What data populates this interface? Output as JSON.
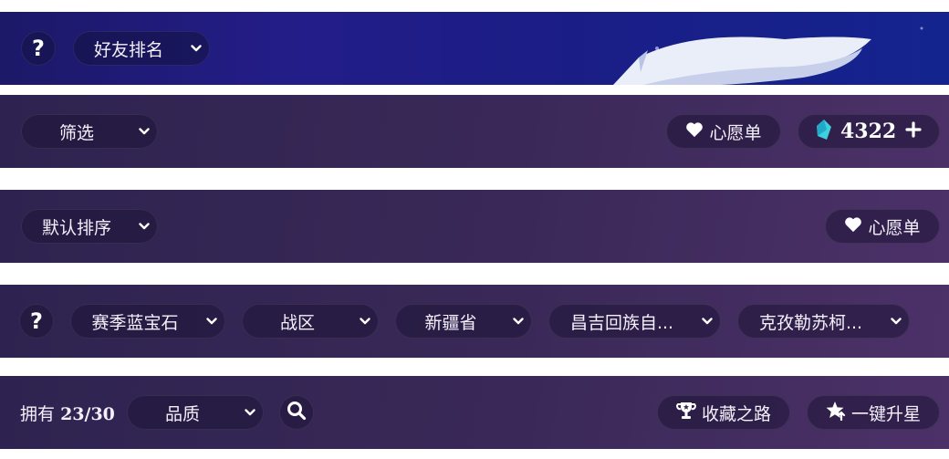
{
  "row1": {
    "help_label": "?",
    "friend_rank": "好友排名"
  },
  "row2": {
    "filter": "筛选",
    "wishlist": "心愿单",
    "gem_count": "4322",
    "add_label": "+"
  },
  "row3": {
    "sort": "默认排序",
    "wishlist": "心愿单"
  },
  "row4": {
    "help_label": "?",
    "filters": [
      "赛季蓝宝石",
      "战区",
      "新疆省",
      "昌吉回族自...",
      "克孜勒苏柯..."
    ]
  },
  "row5": {
    "owned_label": "拥有",
    "owned_count": "23/30",
    "quality": "品质",
    "collection_road": "收藏之路",
    "one_key_star": "一键升星"
  },
  "colors": {
    "gem": "#3fd0e0",
    "bar": "#3a2958",
    "banner": "#1c1c80"
  }
}
